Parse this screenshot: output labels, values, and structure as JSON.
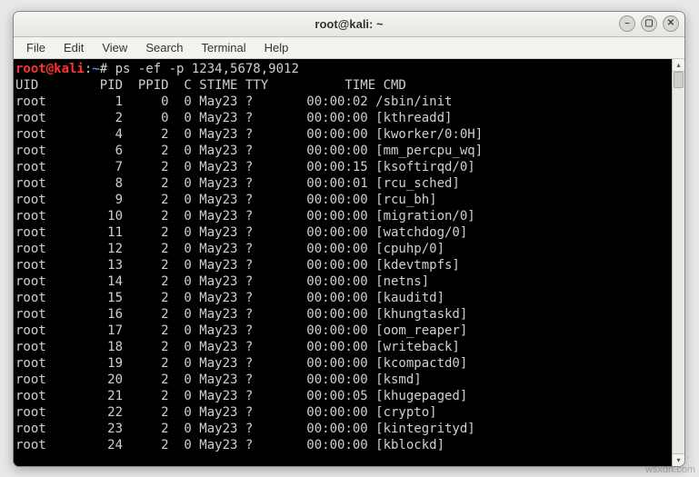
{
  "window_title": "root@kali: ~",
  "menu": [
    "File",
    "Edit",
    "View",
    "Search",
    "Terminal",
    "Help"
  ],
  "prompt": {
    "user_host": "root@kali",
    "sep": ":",
    "path": "~",
    "symbol": "#",
    "command": "ps -ef -p 1234,5678,9012"
  },
  "header": "UID        PID  PPID  C STIME TTY          TIME CMD",
  "rows": [
    {
      "uid": "root",
      "pid": "1",
      "ppid": "0",
      "c": "0",
      "stime": "May23",
      "tty": "?",
      "time": "00:00:02",
      "cmd": "/sbin/init"
    },
    {
      "uid": "root",
      "pid": "2",
      "ppid": "0",
      "c": "0",
      "stime": "May23",
      "tty": "?",
      "time": "00:00:00",
      "cmd": "[kthreadd]"
    },
    {
      "uid": "root",
      "pid": "4",
      "ppid": "2",
      "c": "0",
      "stime": "May23",
      "tty": "?",
      "time": "00:00:00",
      "cmd": "[kworker/0:0H]"
    },
    {
      "uid": "root",
      "pid": "6",
      "ppid": "2",
      "c": "0",
      "stime": "May23",
      "tty": "?",
      "time": "00:00:00",
      "cmd": "[mm_percpu_wq]"
    },
    {
      "uid": "root",
      "pid": "7",
      "ppid": "2",
      "c": "0",
      "stime": "May23",
      "tty": "?",
      "time": "00:00:15",
      "cmd": "[ksoftirqd/0]"
    },
    {
      "uid": "root",
      "pid": "8",
      "ppid": "2",
      "c": "0",
      "stime": "May23",
      "tty": "?",
      "time": "00:00:01",
      "cmd": "[rcu_sched]"
    },
    {
      "uid": "root",
      "pid": "9",
      "ppid": "2",
      "c": "0",
      "stime": "May23",
      "tty": "?",
      "time": "00:00:00",
      "cmd": "[rcu_bh]"
    },
    {
      "uid": "root",
      "pid": "10",
      "ppid": "2",
      "c": "0",
      "stime": "May23",
      "tty": "?",
      "time": "00:00:00",
      "cmd": "[migration/0]"
    },
    {
      "uid": "root",
      "pid": "11",
      "ppid": "2",
      "c": "0",
      "stime": "May23",
      "tty": "?",
      "time": "00:00:00",
      "cmd": "[watchdog/0]"
    },
    {
      "uid": "root",
      "pid": "12",
      "ppid": "2",
      "c": "0",
      "stime": "May23",
      "tty": "?",
      "time": "00:00:00",
      "cmd": "[cpuhp/0]"
    },
    {
      "uid": "root",
      "pid": "13",
      "ppid": "2",
      "c": "0",
      "stime": "May23",
      "tty": "?",
      "time": "00:00:00",
      "cmd": "[kdevtmpfs]"
    },
    {
      "uid": "root",
      "pid": "14",
      "ppid": "2",
      "c": "0",
      "stime": "May23",
      "tty": "?",
      "time": "00:00:00",
      "cmd": "[netns]"
    },
    {
      "uid": "root",
      "pid": "15",
      "ppid": "2",
      "c": "0",
      "stime": "May23",
      "tty": "?",
      "time": "00:00:00",
      "cmd": "[kauditd]"
    },
    {
      "uid": "root",
      "pid": "16",
      "ppid": "2",
      "c": "0",
      "stime": "May23",
      "tty": "?",
      "time": "00:00:00",
      "cmd": "[khungtaskd]"
    },
    {
      "uid": "root",
      "pid": "17",
      "ppid": "2",
      "c": "0",
      "stime": "May23",
      "tty": "?",
      "time": "00:00:00",
      "cmd": "[oom_reaper]"
    },
    {
      "uid": "root",
      "pid": "18",
      "ppid": "2",
      "c": "0",
      "stime": "May23",
      "tty": "?",
      "time": "00:00:00",
      "cmd": "[writeback]"
    },
    {
      "uid": "root",
      "pid": "19",
      "ppid": "2",
      "c": "0",
      "stime": "May23",
      "tty": "?",
      "time": "00:00:00",
      "cmd": "[kcompactd0]"
    },
    {
      "uid": "root",
      "pid": "20",
      "ppid": "2",
      "c": "0",
      "stime": "May23",
      "tty": "?",
      "time": "00:00:00",
      "cmd": "[ksmd]"
    },
    {
      "uid": "root",
      "pid": "21",
      "ppid": "2",
      "c": "0",
      "stime": "May23",
      "tty": "?",
      "time": "00:00:05",
      "cmd": "[khugepaged]"
    },
    {
      "uid": "root",
      "pid": "22",
      "ppid": "2",
      "c": "0",
      "stime": "May23",
      "tty": "?",
      "time": "00:00:00",
      "cmd": "[crypto]"
    },
    {
      "uid": "root",
      "pid": "23",
      "ppid": "2",
      "c": "0",
      "stime": "May23",
      "tty": "?",
      "time": "00:00:00",
      "cmd": "[kintegrityd]"
    },
    {
      "uid": "root",
      "pid": "24",
      "ppid": "2",
      "c": "0",
      "stime": "May23",
      "tty": "?",
      "time": "00:00:00",
      "cmd": "[kblockd]"
    }
  ],
  "watermark": "wsxdn.com"
}
